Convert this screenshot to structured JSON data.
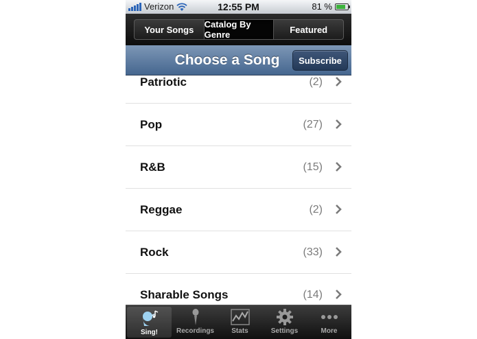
{
  "status_bar": {
    "carrier": "Verizon",
    "time": "12:55 PM",
    "battery": "81 %",
    "battery_level": 0.81
  },
  "segments": [
    {
      "label": "Your Songs",
      "selected": false
    },
    {
      "label": "Catalog By Genre",
      "selected": true
    },
    {
      "label": "Featured",
      "selected": false
    }
  ],
  "nav": {
    "title": "Choose a Song",
    "subscribe_label": "Subscribe"
  },
  "genres": [
    {
      "label": "Patriotic",
      "count": "(2)"
    },
    {
      "label": "Pop",
      "count": "(27)"
    },
    {
      "label": "R&B",
      "count": "(15)"
    },
    {
      "label": "Reggae",
      "count": "(2)"
    },
    {
      "label": "Rock",
      "count": "(33)"
    },
    {
      "label": "Sharable Songs",
      "count": "(14)"
    }
  ],
  "tabs": [
    {
      "label": "Sing!",
      "icon": "singer-icon",
      "active": true
    },
    {
      "label": "Recordings",
      "icon": "microphone-icon",
      "active": false
    },
    {
      "label": "Stats",
      "icon": "chart-icon",
      "active": false
    },
    {
      "label": "Settings",
      "icon": "gear-icon",
      "active": false
    },
    {
      "label": "More",
      "icon": "more-icon",
      "active": false
    }
  ],
  "colors": {
    "accent_blue": "#2a64b8",
    "nav_blue": "#45668f",
    "battery_green": "#3cb23c"
  }
}
